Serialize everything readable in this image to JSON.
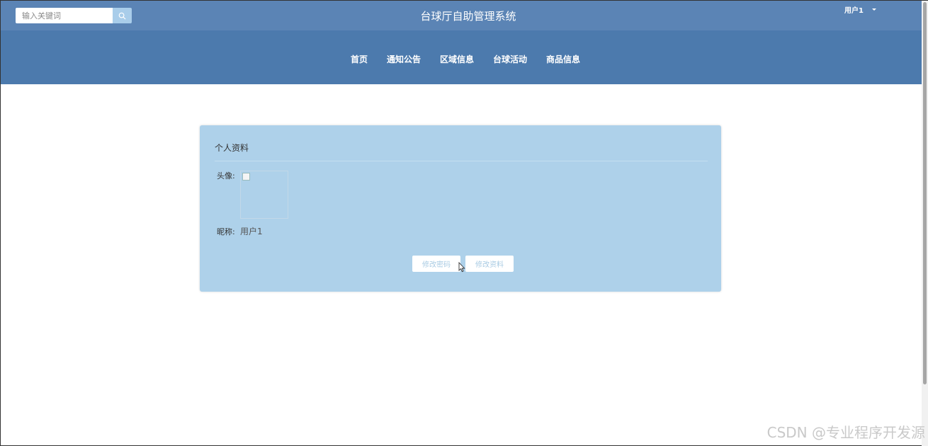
{
  "header": {
    "search_placeholder": "输入关键词",
    "site_title": "台球厅自助管理系统",
    "user_name": "用户1"
  },
  "nav": {
    "items": [
      "首页",
      "通知公告",
      "区域信息",
      "台球活动",
      "商品信息"
    ]
  },
  "profile": {
    "title": "个人资料",
    "avatar_label": "头像:",
    "nickname_label": "昵称:",
    "nickname_value": "用户1",
    "change_password_label": "修改密码",
    "edit_profile_label": "修改资料"
  },
  "watermark": "CSDN @专业程序开发源",
  "colors": {
    "topbar": "#5b84b5",
    "navband": "#4c7aad",
    "card": "#aed1ea",
    "button_text": "#a9cbe3"
  }
}
